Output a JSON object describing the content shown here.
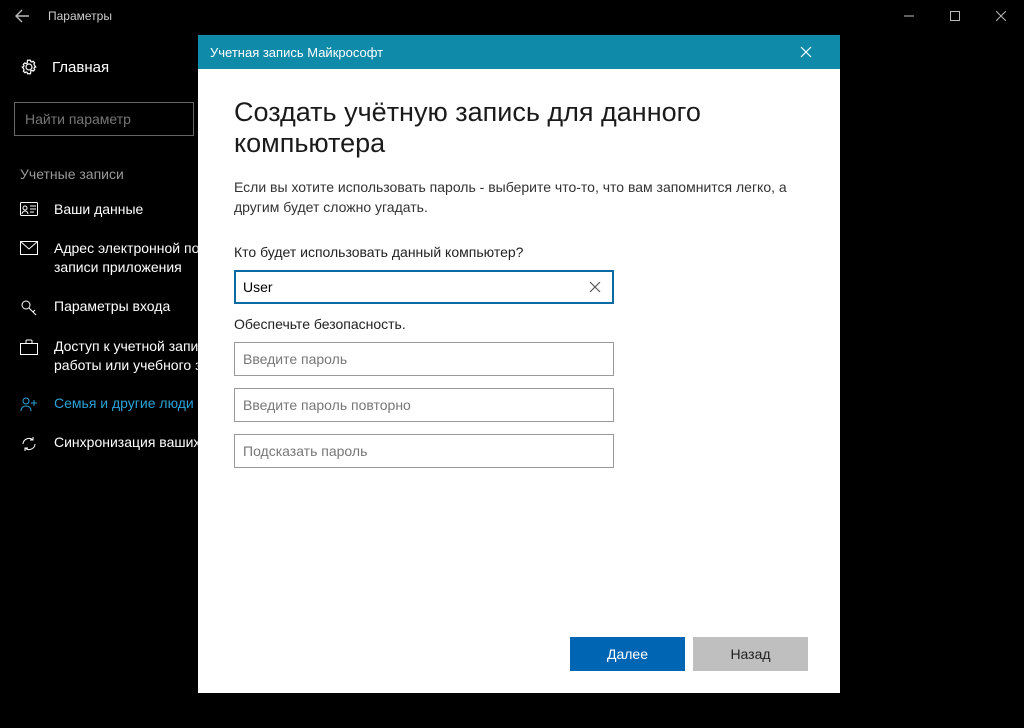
{
  "window": {
    "title": "Параметры"
  },
  "sidebar": {
    "home": "Главная",
    "search_placeholder": "Найти параметр",
    "section": "Учетные записи",
    "items": [
      {
        "label": "Ваши данные"
      },
      {
        "label": "Адрес электронной почты; учетные записи приложения"
      },
      {
        "label": "Параметры входа"
      },
      {
        "label": "Доступ к учетной записи места работы или учебного заведения"
      },
      {
        "label": "Семья и другие люди"
      },
      {
        "label": "Синхронизация ваших параметров"
      }
    ]
  },
  "dialog": {
    "titlebar": "Учетная запись Майкрософт",
    "heading": "Создать учётную запись для данного компьютера",
    "intro": "Если вы хотите использовать пароль - выберите что-то, что вам запомнится легко, а другим будет сложно угадать.",
    "q1": "Кто будет использовать данный компьютер?",
    "username": "User",
    "q2": "Обеспечьте безопасность.",
    "pw_placeholder": "Введите пароль",
    "pw2_placeholder": "Введите пароль повторно",
    "hint_placeholder": "Подсказать пароль",
    "next": "Далее",
    "back": "Назад"
  }
}
